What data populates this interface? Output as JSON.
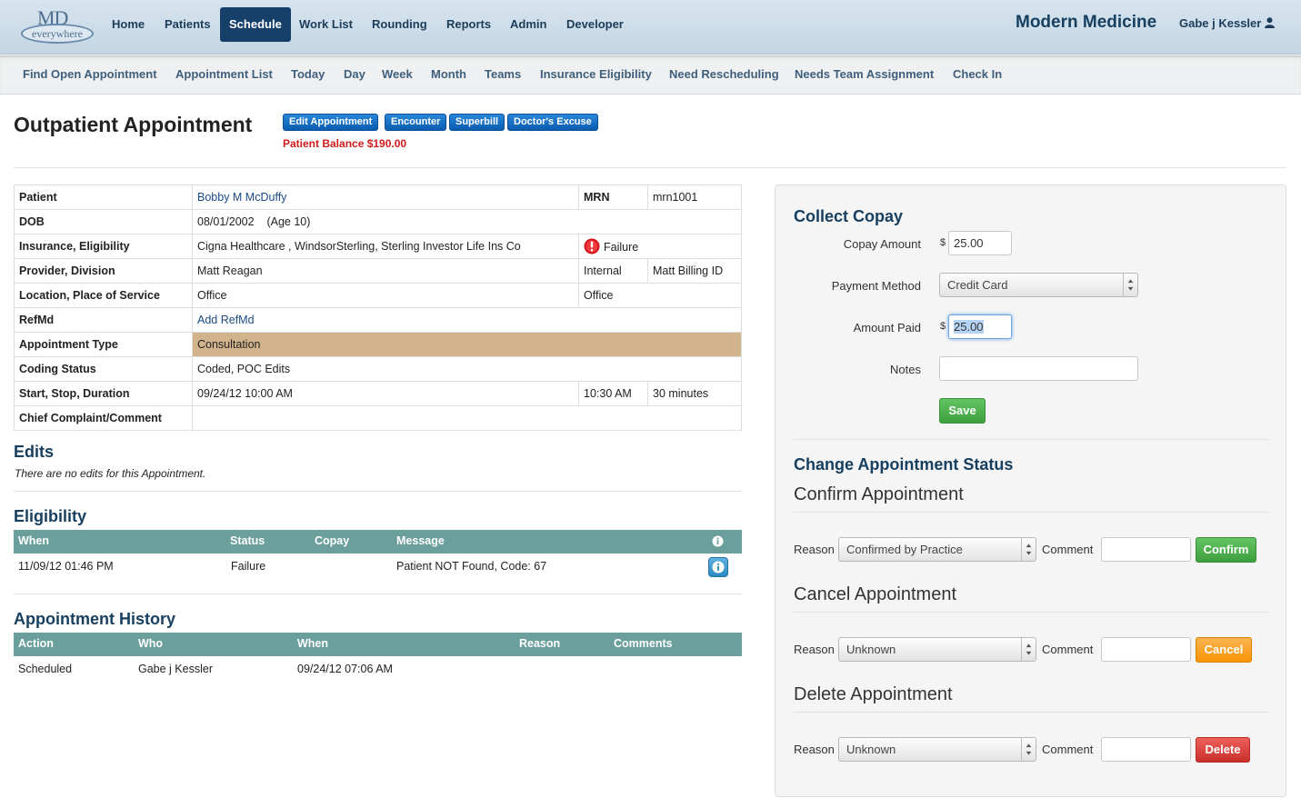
{
  "app": {
    "logo": {
      "md": "MD",
      "everywhere": "everywhere"
    },
    "brand": "Modern Medicine",
    "user": "Gabe j Kessler"
  },
  "nav": {
    "items": [
      "Home",
      "Patients",
      "Schedule",
      "Work List",
      "Rounding",
      "Reports",
      "Admin",
      "Developer"
    ],
    "active": "Schedule"
  },
  "subnav": {
    "items": [
      "Find Open Appointment",
      "Appointment List",
      "Today",
      "Day",
      "Week",
      "Month",
      "Teams",
      "Insurance Eligibility",
      "Need Rescheduling",
      "Needs Team Assignment",
      "Check In"
    ]
  },
  "header": {
    "title": "Outpatient Appointment",
    "buttons": [
      "Edit Appointment",
      "Encounter",
      "Superbill",
      "Doctor's Excuse"
    ],
    "balance": "Patient Balance $190.00"
  },
  "details": {
    "patient_label": "Patient",
    "patient": "Bobby M McDuffy",
    "mrn_label": "MRN",
    "mrn": "mrn1001",
    "dob_label": "DOB",
    "dob": "08/01/2002",
    "age": "(Age 10)",
    "insurance_label": "Insurance, Eligibility",
    "insurance": "Cigna Healthcare , WindsorSterling, Sterling Investor Life Ins Co",
    "eligibility": "Failure",
    "provider_label": "Provider, Division",
    "provider": "Matt Reagan",
    "division": "Internal",
    "billing_id": "Matt Billing ID",
    "location_label": "Location, Place of Service",
    "location": "Office",
    "place_of_service": "Office",
    "refmd_label": "RefMd",
    "refmd_link": "Add RefMd",
    "appt_type_label": "Appointment Type",
    "appt_type": "Consultation",
    "coding_label": "Coding Status",
    "coding": "Coded, POC Edits",
    "start_label": "Start, Stop, Duration",
    "start": "09/24/12 10:00 AM",
    "stop": "10:30 AM",
    "duration": "30 minutes",
    "complaint_label": "Chief Complaint/Comment",
    "complaint": ""
  },
  "edits": {
    "title": "Edits",
    "note": "There are no edits for this Appointment."
  },
  "eligibility": {
    "title": "Eligibility",
    "columns": [
      "When",
      "Status",
      "Copay",
      "Message"
    ],
    "rows": [
      {
        "when": "11/09/12 01:46 PM",
        "status": "Failure",
        "copay": "",
        "message": "Patient NOT Found, Code: 67"
      }
    ]
  },
  "history": {
    "title": "Appointment History",
    "columns": [
      "Action",
      "Who",
      "When",
      "Reason",
      "Comments"
    ],
    "rows": [
      {
        "action": "Scheduled",
        "who": "Gabe j Kessler",
        "when": "09/24/12 07:06 AM",
        "reason": "",
        "comments": ""
      }
    ]
  },
  "copay": {
    "title": "Collect Copay",
    "amount_label": "Copay Amount",
    "currency": "$",
    "amount": "25.00",
    "method_label": "Payment Method",
    "method": "Credit Card",
    "paid_label": "Amount Paid",
    "paid": "25.00",
    "notes_label": "Notes",
    "notes": "",
    "save": "Save"
  },
  "status": {
    "title": "Change Appointment Status",
    "confirm": {
      "title": "Confirm Appointment",
      "reason_label": "Reason",
      "reason": "Confirmed by Practice",
      "comment_label": "Comment",
      "button": "Confirm"
    },
    "cancel": {
      "title": "Cancel Appointment",
      "reason_label": "Reason",
      "reason": "Unknown",
      "comment_label": "Comment",
      "button": "Cancel"
    },
    "delete": {
      "title": "Delete Appointment",
      "reason_label": "Reason",
      "reason": "Unknown",
      "comment_label": "Comment",
      "button": "Delete"
    }
  },
  "colors": {
    "nav_active": "#16406a",
    "accent": "#173f60",
    "grid_header": "#6b9f9c",
    "appt_type_bg": "#d2b48c",
    "balance": "#d11a1a"
  }
}
